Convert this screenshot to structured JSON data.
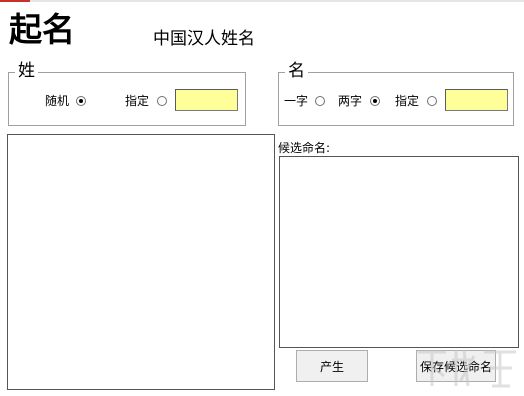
{
  "header": {
    "title": "起名",
    "subtitle": "中国汉人姓名"
  },
  "surname_group": {
    "legend": "姓",
    "random_label": "随机",
    "random_selected": true,
    "specify_label": "指定",
    "specify_selected": false,
    "specify_value": ""
  },
  "given_group": {
    "legend": "名",
    "one_char_label": "一字",
    "one_char_selected": false,
    "two_char_label": "两字",
    "two_char_selected": true,
    "specify_label": "指定",
    "specify_selected": false,
    "specify_value": ""
  },
  "candidates": {
    "label": "候选命名:"
  },
  "buttons": {
    "generate": "产生",
    "save": "保存候选命名"
  },
  "colors": {
    "input_bg": "#ffff99",
    "window_bg": "#ffffff"
  }
}
